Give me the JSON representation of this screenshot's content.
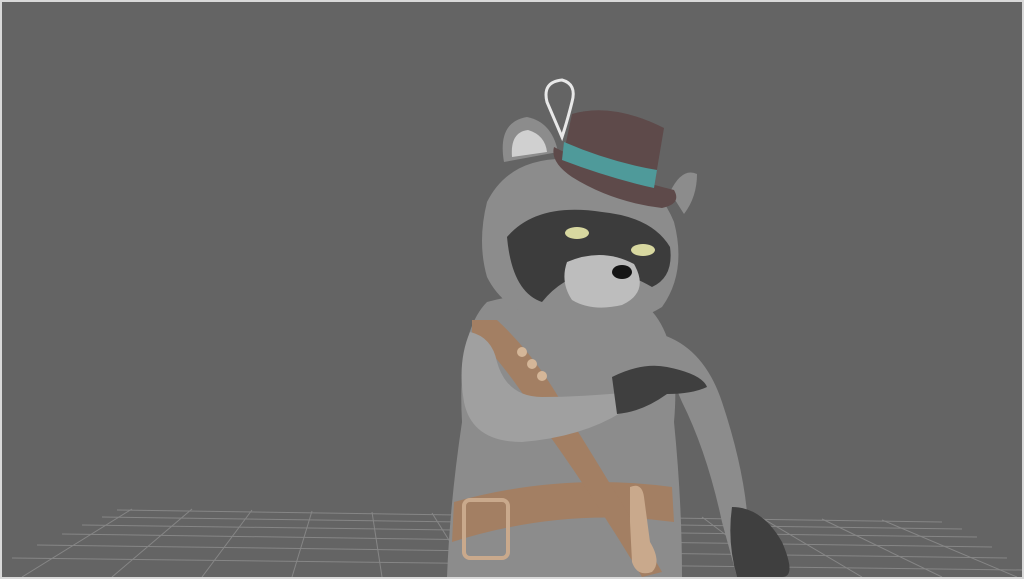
{
  "viewport": {
    "background": "#646464",
    "border_color": "#d9d9d9",
    "grid_color": "#8a8a8a"
  },
  "character": {
    "kind": "raccoon",
    "colors": {
      "fur": "#8c8c8c",
      "fur_light": "#a8a8a8",
      "mask": "#3c3c3c",
      "hat": "#5e4a4a",
      "hat_band": "#4f9a9a",
      "strap": "#a37f63",
      "eyes": "#d8d8a0"
    }
  }
}
